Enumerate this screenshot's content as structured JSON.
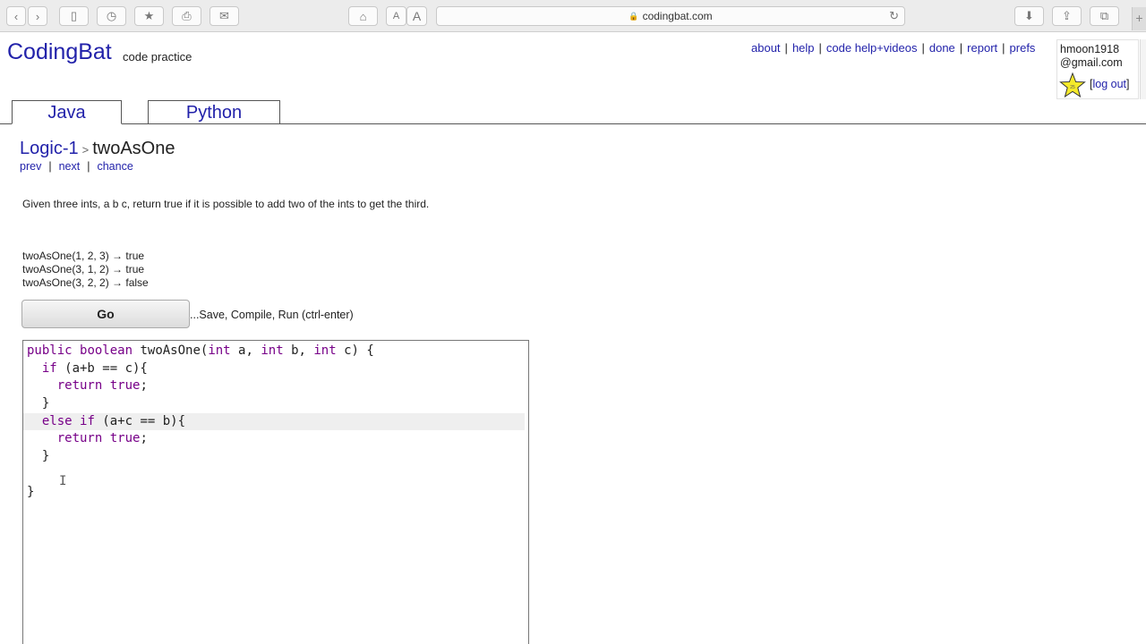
{
  "browser": {
    "url": "codingbat.com",
    "buttons": {
      "back": "‹",
      "forward": "›",
      "sidebar": "▯",
      "history": "◷",
      "bookmarks": "★",
      "print": "⎙",
      "mail": "✉",
      "home": "⌂",
      "font_small": "A",
      "font_large": "A",
      "reload": "↻",
      "downloads": "⬇",
      "share": "⇪",
      "tabs": "⧉",
      "new_tab": "+"
    }
  },
  "site": {
    "logo": "CodingBat",
    "logo_sub": "code practice",
    "nav": [
      "about",
      "help",
      "code help+videos",
      "done",
      "report",
      "prefs"
    ],
    "user": {
      "email_line1": "hmoon1918",
      "email_line2": "@gmail.com",
      "logout": "log out",
      "logout_open": "[",
      "logout_close": "]"
    },
    "tabs": [
      "Java",
      "Python"
    ]
  },
  "problem": {
    "category": "Logic-1",
    "sep": ">",
    "name": "twoAsOne",
    "nav": [
      "prev",
      "next",
      "chance"
    ],
    "description": "Given three ints, a b c, return true if it is possible to add two of the ints to get the third.",
    "examples": [
      "twoAsOne(1, 2, 3) → true",
      "twoAsOne(3, 1, 2) → true",
      "twoAsOne(3, 2, 2) → false"
    ],
    "go_label": "Go",
    "go_hint": "...Save, Compile, Run (ctrl-enter)"
  },
  "code": {
    "lines": [
      "public boolean twoAsOne(int a, int b, int c) {",
      "  if (a+b == c){",
      "    return true;",
      "  }",
      "  else if (a+c == b){",
      "    return true;",
      "  }",
      "",
      "}"
    ],
    "highlighted_line": 5
  },
  "colors": {
    "link": "#2222aa",
    "keyword": "#770088",
    "star": "#f5ea2a"
  }
}
